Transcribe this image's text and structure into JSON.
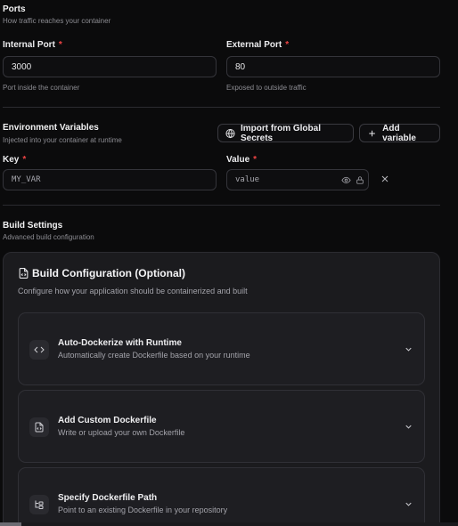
{
  "ports": {
    "title": "Ports",
    "subtitle": "How traffic reaches your container",
    "internal": {
      "label": "Internal Port",
      "required": "*",
      "value": "3000",
      "help": "Port inside the container"
    },
    "external": {
      "label": "External Port",
      "required": "*",
      "value": "80",
      "help": "Exposed to outside traffic"
    }
  },
  "env": {
    "title": "Environment Variables",
    "subtitle": "Injected into your container at runtime",
    "import_label": "Import from Global Secrets",
    "add_label": "Add variable",
    "key": {
      "label": "Key",
      "required": "*",
      "placeholder": "MY_VAR"
    },
    "value": {
      "label": "Value",
      "required": "*",
      "placeholder": "value"
    }
  },
  "build": {
    "title": "Build Settings",
    "subtitle": "Advanced build configuration",
    "card_title": "Build Configuration (Optional)",
    "card_desc": "Configure how your application should be containerized and built",
    "options": [
      {
        "title": "Auto-Dockerize with Runtime",
        "desc": "Automatically create Dockerfile based on your runtime",
        "icon": "code-icon"
      },
      {
        "title": "Add Custom Dockerfile",
        "desc": "Write or upload your own Dockerfile",
        "icon": "file-code-icon"
      },
      {
        "title": "Specify Dockerfile Path",
        "desc": "Point to an existing Dockerfile in your repository",
        "icon": "folder-tree-icon"
      }
    ]
  },
  "colors": {
    "background": "#0b0b0c",
    "card": "#1b1b1e",
    "required": "#ef4444",
    "border": "#34343a"
  }
}
